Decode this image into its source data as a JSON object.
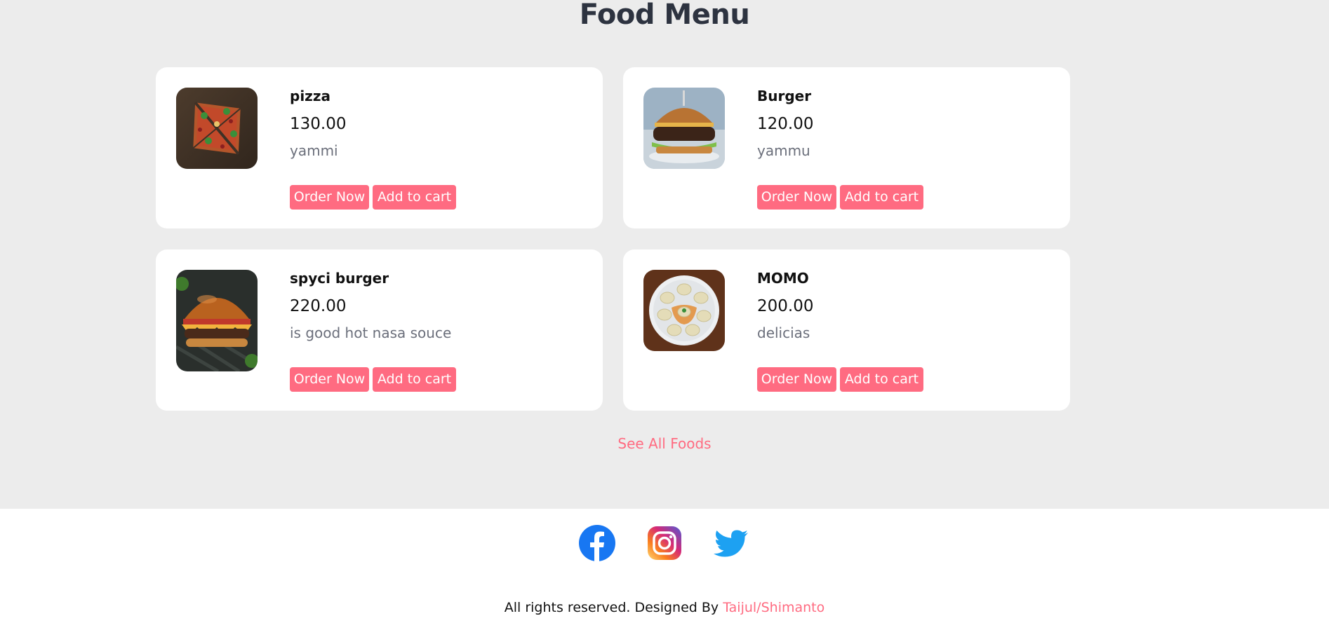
{
  "page_title": "Food Menu",
  "items": [
    {
      "name": "pizza",
      "price": "130.00",
      "description": "yammi",
      "image_icon": "pizza-icon"
    },
    {
      "name": "Burger",
      "price": "120.00",
      "description": "yammu",
      "image_icon": "burger-icon"
    },
    {
      "name": "spyci burger",
      "price": "220.00",
      "description": "is good hot nasa souce",
      "image_icon": "cheeseburger-icon"
    },
    {
      "name": "MOMO",
      "price": "200.00",
      "description": "delicias",
      "image_icon": "momo-icon"
    }
  ],
  "buttons": {
    "order_label": "Order Now",
    "cart_label": "Add to cart"
  },
  "see_all_label": "See All Foods",
  "footer": {
    "social": [
      "facebook-icon",
      "instagram-icon",
      "twitter-icon"
    ],
    "credits_prefix": "All rights reserved. Designed By ",
    "credits_author": "Taijul/Shimanto"
  },
  "colors": {
    "accent": "#ff6b81",
    "title": "#2d3340",
    "background": "#ececec",
    "card": "#ffffff"
  }
}
